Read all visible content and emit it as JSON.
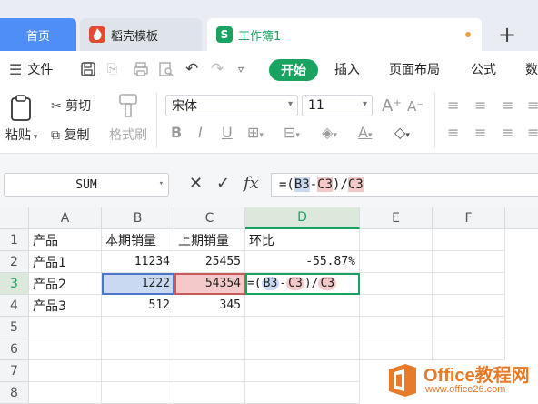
{
  "tabs": {
    "home": "首页",
    "template": "稻壳模板",
    "workbook": "工作簿1",
    "workbook_icon": "S",
    "new_tab": "+"
  },
  "menu": {
    "file": "文件",
    "start": "开始",
    "insert": "插入",
    "layout": "页面布局",
    "formula": "公式",
    "data": "数"
  },
  "ribbon": {
    "paste": "粘贴",
    "cut": "剪切",
    "copy": "复制",
    "format_painter": "格式刷",
    "font_name": "宋体",
    "font_size": "11"
  },
  "formula_bar": {
    "name_box": "SUM",
    "cancel": "✕",
    "confirm": "✓",
    "fx": "fx",
    "formula_prefix": "=(",
    "ref1": "B3",
    "op1": "-",
    "ref2": "C3",
    "op2": ")/",
    "ref3": "C3"
  },
  "sheet": {
    "columns": [
      "A",
      "B",
      "C",
      "D",
      "E",
      "F"
    ],
    "rows": [
      "1",
      "2",
      "3",
      "4",
      "5",
      "6",
      "7",
      "8"
    ],
    "cells": {
      "A1": "产品",
      "B1": "本期销量",
      "C1": "上期销量",
      "D1": "环比",
      "A2": "产品1",
      "B2": "11234",
      "C2": "25455",
      "D2": "-55.87%",
      "A3": "产品2",
      "B3": "1222",
      "C3": "54354",
      "A4": "产品3",
      "B4": "512",
      "C4": "345"
    },
    "edit_cell": {
      "prefix": "=(",
      "ref1": "B3",
      "op1": "-",
      "ref2": "C3",
      "op2": ")/",
      "ref3": "C3"
    },
    "active_cell": "D3"
  },
  "watermark": {
    "title": "Office教程网",
    "url": "www.office26.com"
  },
  "colors": {
    "accent": "#1aa260",
    "home_tab": "#4f8ef7",
    "ref_blue": "#c9d9f2",
    "ref_red": "#f3c9c9",
    "watermark": "#e87b2a"
  }
}
